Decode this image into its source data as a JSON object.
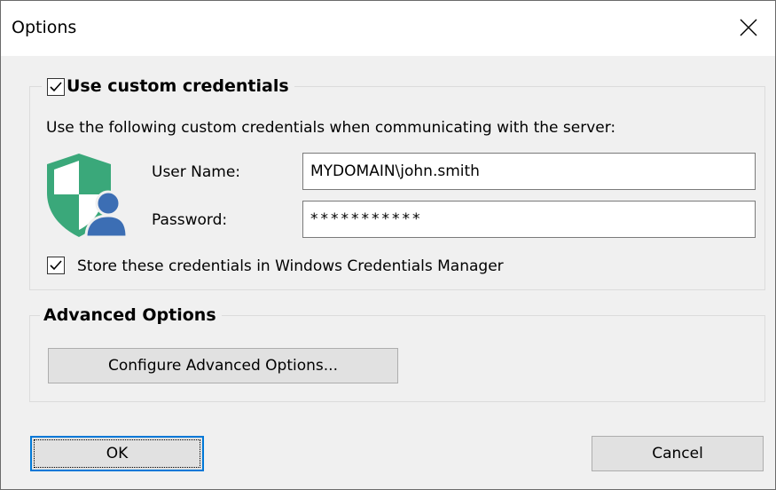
{
  "window": {
    "title": "Options",
    "close_icon": "close-icon"
  },
  "credentials_group": {
    "checkbox_checked": true,
    "title": "Use custom credentials",
    "description": "Use the following custom credentials when communicating with the server:",
    "icon": "shield-user-icon",
    "username_label": "User Name:",
    "username_value": "MYDOMAIN\\john.smith",
    "password_label": "Password:",
    "password_value": "***********",
    "store_checked": true,
    "store_label": "Store these credentials in Windows Credentials Manager"
  },
  "advanced_group": {
    "title": "Advanced Options",
    "configure_button": "Configure Advanced Options..."
  },
  "footer": {
    "ok_label": "OK",
    "cancel_label": "Cancel"
  },
  "colors": {
    "shield_green": "#3aa87a",
    "shield_light": "#ffffff",
    "user_blue": "#3c6eb4",
    "accent": "#0078d7"
  }
}
